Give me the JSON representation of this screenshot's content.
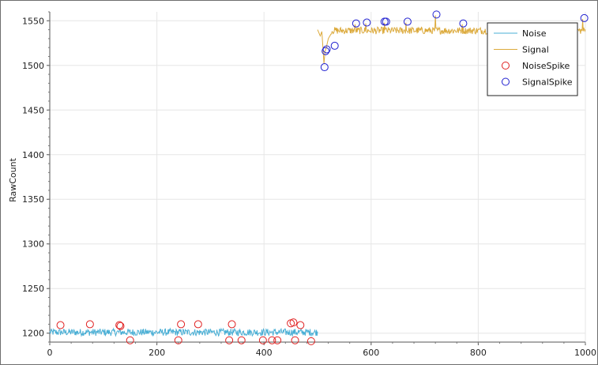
{
  "chart_data": {
    "type": "line",
    "title": "",
    "xlabel": "",
    "ylabel": "RawCount",
    "xlim": [
      0,
      1000
    ],
    "ylim": [
      1190,
      1560
    ],
    "x_ticks": [
      0,
      200,
      400,
      600,
      800,
      1000
    ],
    "y_ticks": [
      1200,
      1250,
      1300,
      1350,
      1400,
      1450,
      1500,
      1550
    ],
    "grid": true,
    "legend_position": "top-right",
    "series": [
      {
        "name": "Noise",
        "kind": "line",
        "color": "#4AAFD5",
        "x_range": [
          0,
          500
        ],
        "baseline": 1201,
        "jitter": 4
      },
      {
        "name": "Signal",
        "kind": "line",
        "color": "#DCAA3C",
        "x_range": [
          500,
          1000
        ],
        "baseline": 1539,
        "jitter": 4,
        "start_points": [
          [
            500,
            1540
          ],
          [
            505,
            1533
          ],
          [
            508,
            1538
          ],
          [
            510,
            1520
          ],
          [
            512,
            1502
          ],
          [
            514,
            1516
          ],
          [
            516,
            1519
          ],
          [
            520,
            1530
          ],
          [
            525,
            1535
          ]
        ],
        "spikes": [
          [
            570,
            1546
          ],
          [
            590,
            1547
          ],
          [
            625,
            1548
          ],
          [
            665,
            1548
          ],
          [
            720,
            1556
          ],
          [
            770,
            1546
          ],
          [
            995,
            1552
          ]
        ]
      },
      {
        "name": "NoiseSpike",
        "kind": "marker",
        "color": "#E02020",
        "points": [
          [
            20,
            1209
          ],
          [
            75,
            1210
          ],
          [
            130,
            1209
          ],
          [
            132,
            1208
          ],
          [
            150,
            1192
          ],
          [
            240,
            1192
          ],
          [
            245,
            1210
          ],
          [
            277,
            1210
          ],
          [
            335,
            1192
          ],
          [
            340,
            1210
          ],
          [
            358,
            1192
          ],
          [
            398,
            1192
          ],
          [
            415,
            1192
          ],
          [
            425,
            1192
          ],
          [
            450,
            1211
          ],
          [
            455,
            1212
          ],
          [
            458,
            1192
          ],
          [
            468,
            1209
          ],
          [
            488,
            1191
          ]
        ]
      },
      {
        "name": "SignalSpike",
        "kind": "marker",
        "color": "#2020D0",
        "points": [
          [
            513,
            1498
          ],
          [
            515,
            1516
          ],
          [
            517,
            1518
          ],
          [
            532,
            1522
          ],
          [
            572,
            1547
          ],
          [
            592,
            1548
          ],
          [
            625,
            1549
          ],
          [
            628,
            1549
          ],
          [
            668,
            1549
          ],
          [
            722,
            1557
          ],
          [
            772,
            1547
          ],
          [
            998,
            1553
          ]
        ]
      }
    ]
  }
}
